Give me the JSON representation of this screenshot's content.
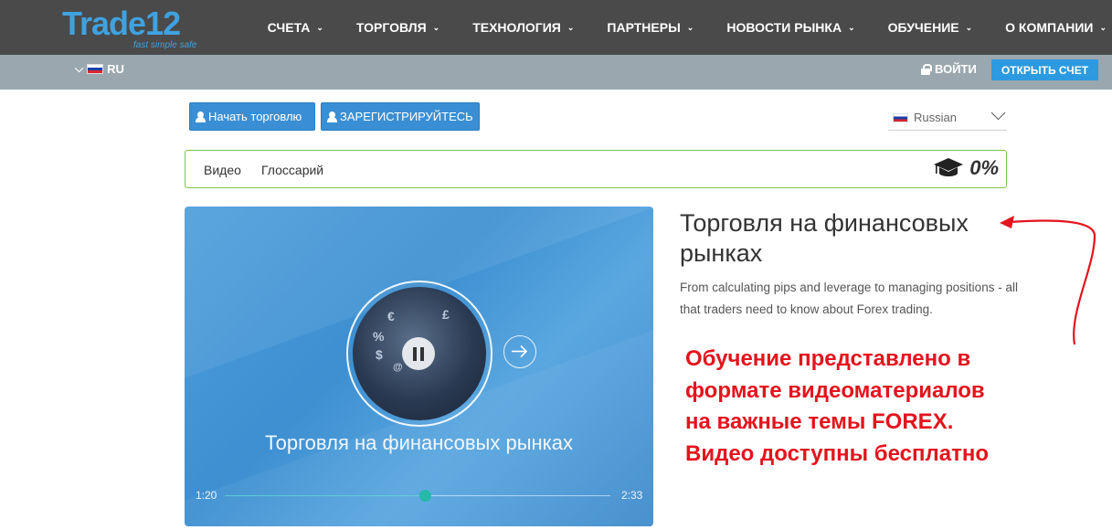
{
  "brand": {
    "logo_text": "Trade12",
    "tagline": "fast simple safe",
    "colors": {
      "accent": "#3fa2e0",
      "topbar": "#4a4a4a",
      "subbar": "#9aa7ae",
      "cta": "#2c9ae0",
      "progress_green": "#7ec24b",
      "annotation_red": "#e4131d"
    }
  },
  "nav": {
    "items": [
      {
        "label": "СЧЕТА"
      },
      {
        "label": "ТОРГОВЛЯ"
      },
      {
        "label": "ТЕХНОЛОГИЯ"
      },
      {
        "label": "ПАРТНЕРЫ"
      },
      {
        "label": "НОВОСТИ РЫНКА"
      },
      {
        "label": "ОБУЧЕНИЕ"
      },
      {
        "label": "О КОМПАНИИ"
      }
    ]
  },
  "subbar": {
    "lang": "RU",
    "login": "ВОЙТИ",
    "open_account": "ОТКРЫТЬ СЧЕТ"
  },
  "actions": {
    "start_trading": "Начать торговлю",
    "register": "ЗАРЕГИСТРИРУЙТЕСЬ"
  },
  "language_dropdown": {
    "selected": "Russian"
  },
  "tabs": {
    "video": "Видео",
    "glossary": "Глоссарий",
    "progress": "0%"
  },
  "video": {
    "title": "Торговля на финансовых рынках",
    "time_current": "1:20",
    "time_total": "2:33",
    "progress_fraction": 0.52
  },
  "description": {
    "title": "Торговля на финансовых рынках",
    "body": "From calculating pips and leverage to managing positions - all that traders need to know about Forex trading."
  },
  "annotation": {
    "lines": [
      "Обучение представлено в",
      "формате видеоматериалов",
      "на важные темы FOREX.",
      "Видео доступны бесплатно"
    ]
  }
}
